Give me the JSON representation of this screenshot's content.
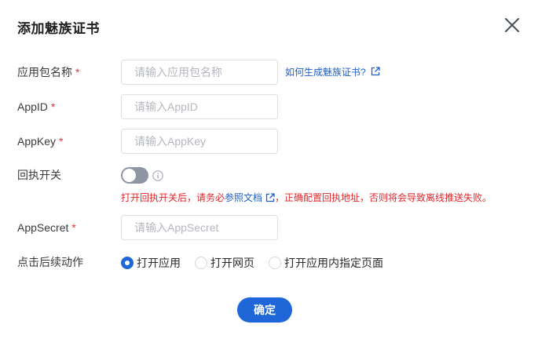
{
  "dialog": {
    "title": "添加魅族证书"
  },
  "fields": {
    "package_name": {
      "label": "应用包名称",
      "required_mark": "*",
      "placeholder": "请输入应用包名称"
    },
    "app_id": {
      "label": "AppID",
      "required_mark": "*",
      "placeholder": "请输入AppID"
    },
    "app_key": {
      "label": "AppKey",
      "required_mark": "*",
      "placeholder": "请输入AppKey"
    },
    "callback_switch": {
      "label": "回执开关",
      "enabled": false
    },
    "app_secret": {
      "label": "AppSecret",
      "required_mark": "*",
      "placeholder": "请输入AppSecret"
    },
    "click_action": {
      "label": "点击后续动作",
      "options": [
        "打开应用",
        "打开网页",
        "打开应用内指定页面"
      ],
      "selected": "打开应用"
    }
  },
  "help_link": {
    "label": "如何生成魅族证书?",
    "icon": "external-link-icon"
  },
  "warning": {
    "before": "打开回执开关后，请务必",
    "link": "参照文档",
    "after": "，正确配置回执地址，否则将会导致离线推送失败。"
  },
  "confirm_button": {
    "label": "确定"
  },
  "colors": {
    "primary": "#1f67d8",
    "link": "#1f5fc9",
    "required": "#e0393e",
    "warning": "#e3262b",
    "toggle_off": "#8f96a3"
  }
}
